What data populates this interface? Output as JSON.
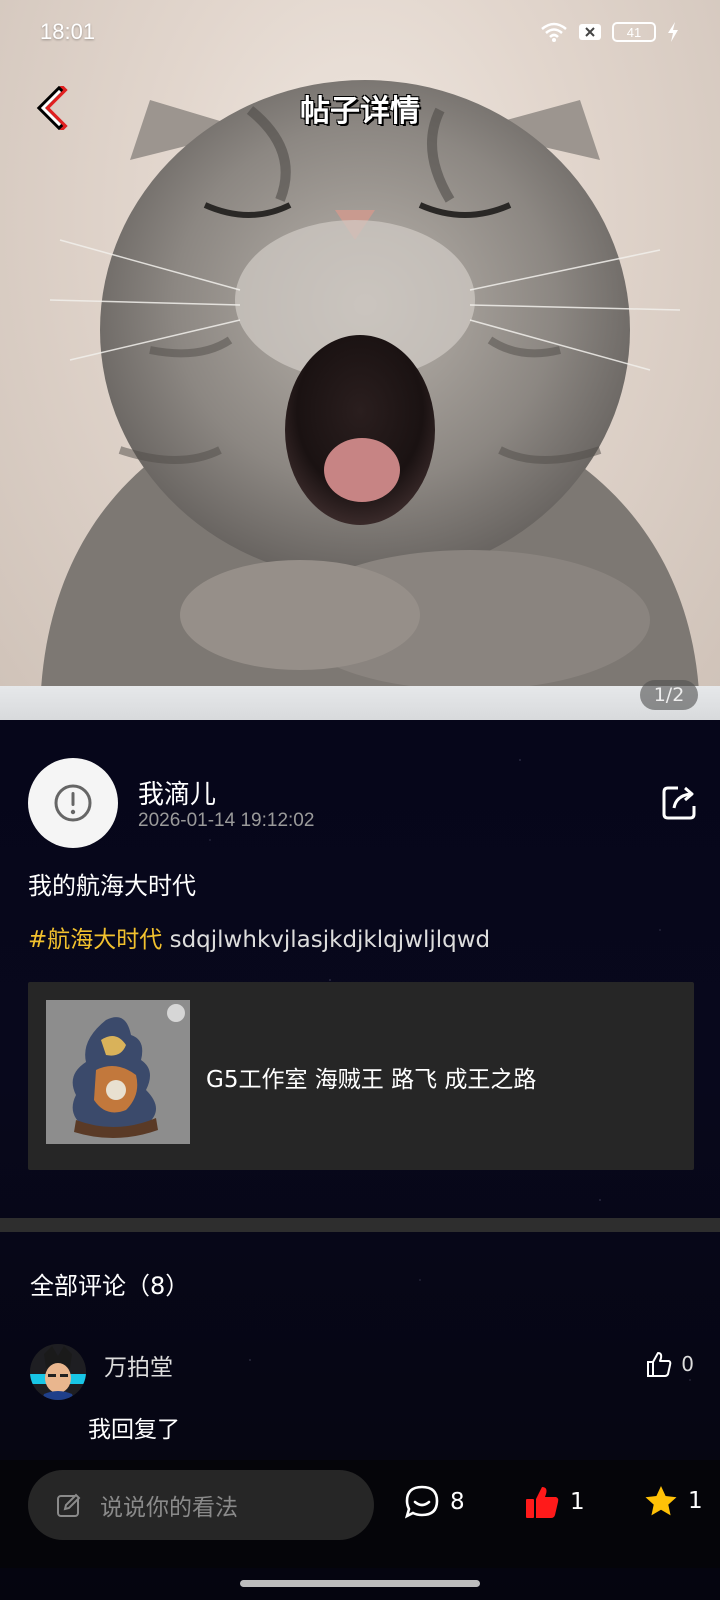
{
  "status_bar": {
    "time": "18:01",
    "battery": "41"
  },
  "header": {
    "title": "帖子详情"
  },
  "gallery": {
    "counter": "1/2"
  },
  "post": {
    "author": "我滴儿",
    "time": "2026-01-14 19:12:02",
    "title": "我的航海大时代",
    "hashtag": "#航海大时代",
    "body": " sdqjlwhkvjlasjkdjklqjwljlqwd"
  },
  "product": {
    "title": "G5工作室 海贼王 路飞 成王之路"
  },
  "comments": {
    "heading": "全部评论（8）",
    "items": [
      {
        "user": "万拍堂",
        "text": "我回复了",
        "likes": "0"
      }
    ]
  },
  "bottom_bar": {
    "placeholder": "说说你的看法",
    "comment_count": "8",
    "like_count": "1",
    "fav_count": "1"
  },
  "colors": {
    "hashtag": "#f2c12e",
    "like_active": "#ff1a1a",
    "fav_active": "#ffc107"
  },
  "icons": [
    "back-icon",
    "wifi-icon",
    "sim-icon",
    "battery-icon",
    "charging-icon",
    "alert-icon",
    "share-icon",
    "thumbs-up-icon",
    "edit-icon",
    "comment-icon",
    "star-icon"
  ]
}
